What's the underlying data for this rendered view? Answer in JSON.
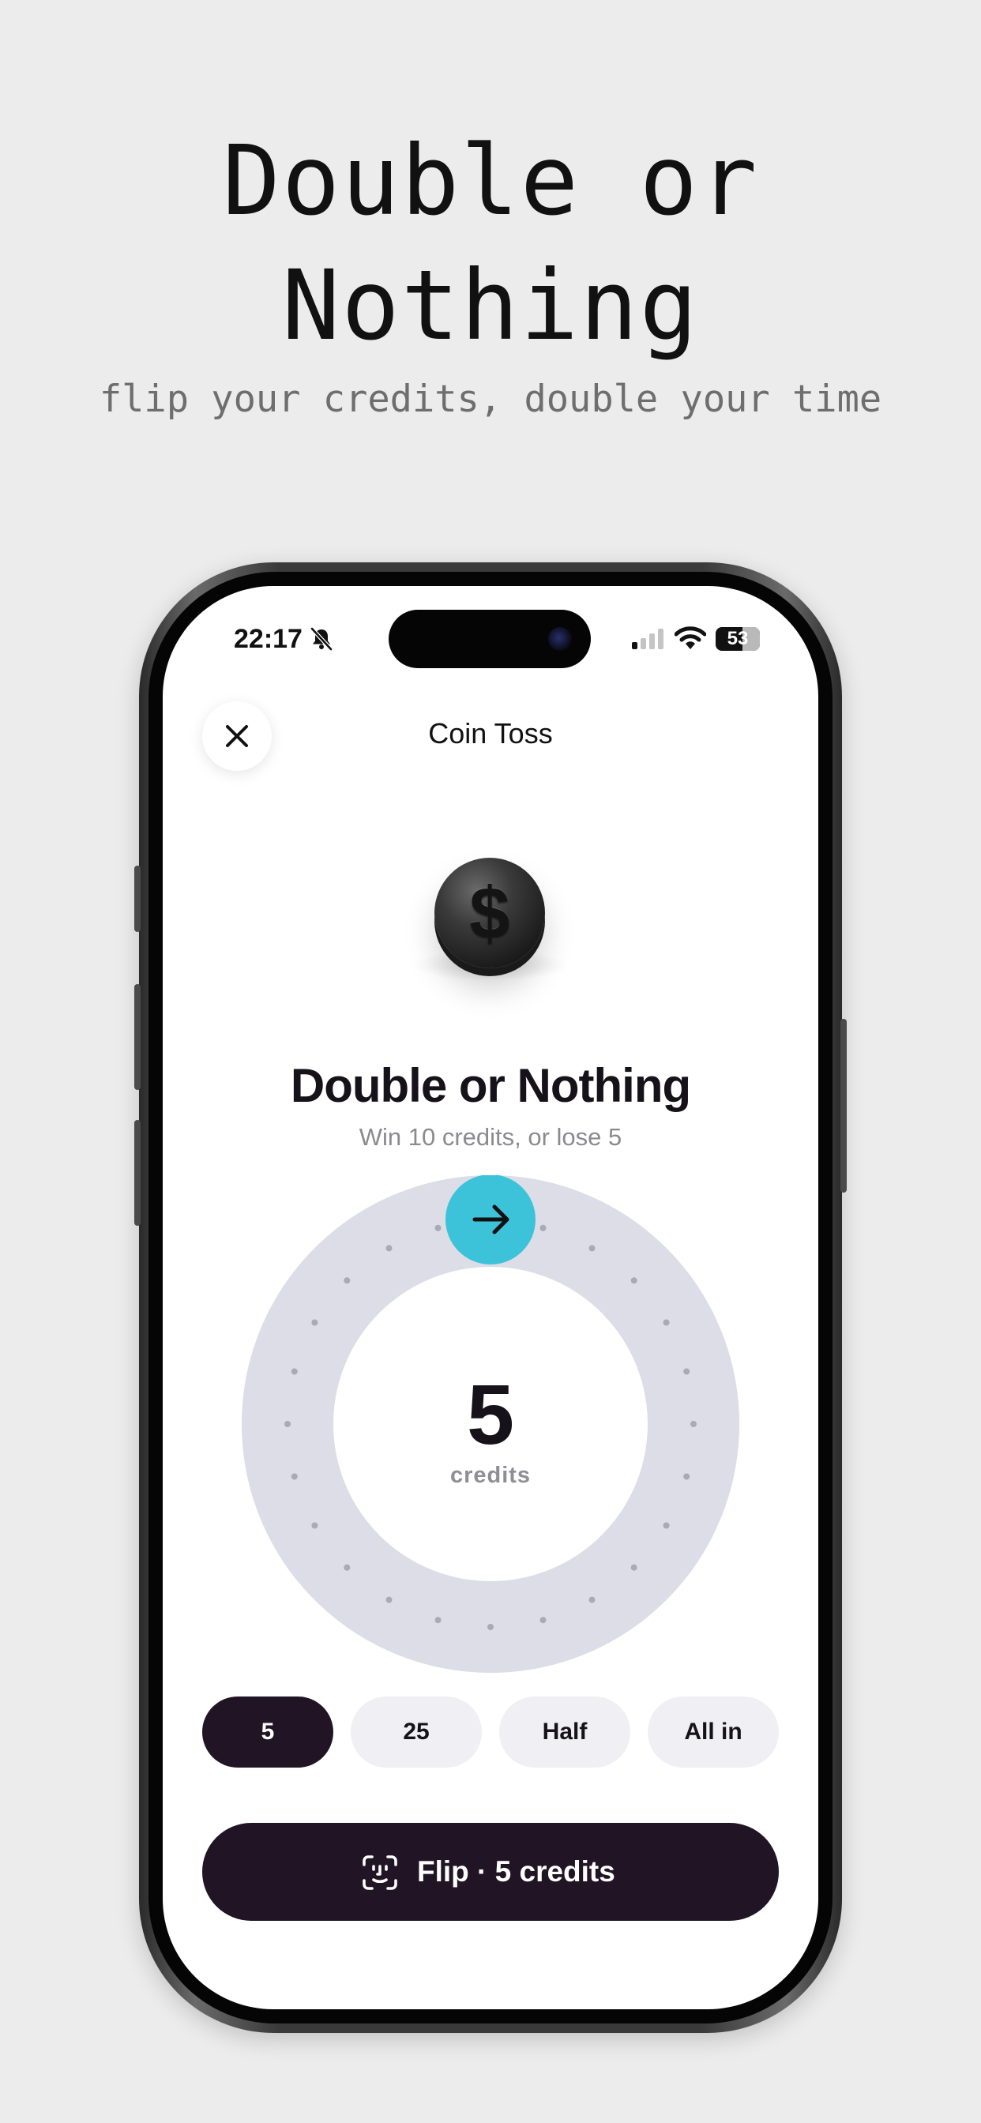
{
  "hero": {
    "title": "Double or Nothing",
    "subtitle": "flip your credits, double your time"
  },
  "status_bar": {
    "time": "22:17",
    "battery": "53",
    "icons": [
      "bell-muted-icon",
      "signal-icon",
      "wifi-icon",
      "battery-icon"
    ]
  },
  "nav": {
    "title": "Coin Toss",
    "close_icon": "close-icon"
  },
  "game": {
    "coin_symbol": "$",
    "title": "Double or Nothing",
    "subtitle": "Win 10 credits, or lose 5",
    "amount": "5",
    "amount_unit": "credits",
    "dial_handle_icon": "arrow-right-icon"
  },
  "chips": {
    "selected": "5",
    "items": [
      {
        "label": "5"
      },
      {
        "label": "25"
      },
      {
        "label": "Half"
      },
      {
        "label": "All in"
      }
    ]
  },
  "primary_action": {
    "label": "Flip · 5 credits",
    "icon": "face-id-icon"
  },
  "colors": {
    "page_background": "#ececec",
    "dark_accent": "#211424",
    "handle_accent": "#3cc3d9",
    "dial_track": "#dcdde6"
  }
}
